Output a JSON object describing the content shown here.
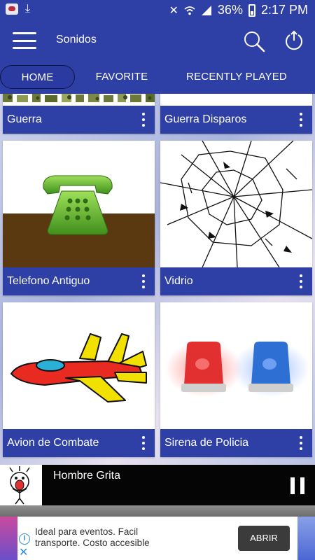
{
  "status_bar": {
    "battery_percent": "36%",
    "time": "2:17 PM",
    "icons": [
      "app-notification-icon",
      "download-icon",
      "mute-icon",
      "wifi-icon",
      "signal-icon",
      "battery-icon"
    ]
  },
  "app_bar": {
    "title": "Sonidos",
    "icons": [
      "menu-icon",
      "search-icon",
      "power-icon"
    ]
  },
  "tabs": [
    {
      "label": "HOME",
      "selected": true
    },
    {
      "label": "FAVORITE",
      "selected": false
    },
    {
      "label": "RECENTLY PLAYED",
      "selected": false
    }
  ],
  "sounds": [
    {
      "name": "Guerra"
    },
    {
      "name": "Guerra Disparos"
    },
    {
      "name": "Telefono Antiguo"
    },
    {
      "name": "Vidrio"
    },
    {
      "name": "Avion de Combate"
    },
    {
      "name": "Sirena de Policia"
    }
  ],
  "player": {
    "title": "Hombre Grita",
    "state": "playing"
  },
  "ad": {
    "text": "Ideal para eventos. Facil transporte. Costo accesible",
    "button": "ABRIR"
  },
  "colors": {
    "primary": "#2e3fa6",
    "player_bg": "#050505"
  }
}
